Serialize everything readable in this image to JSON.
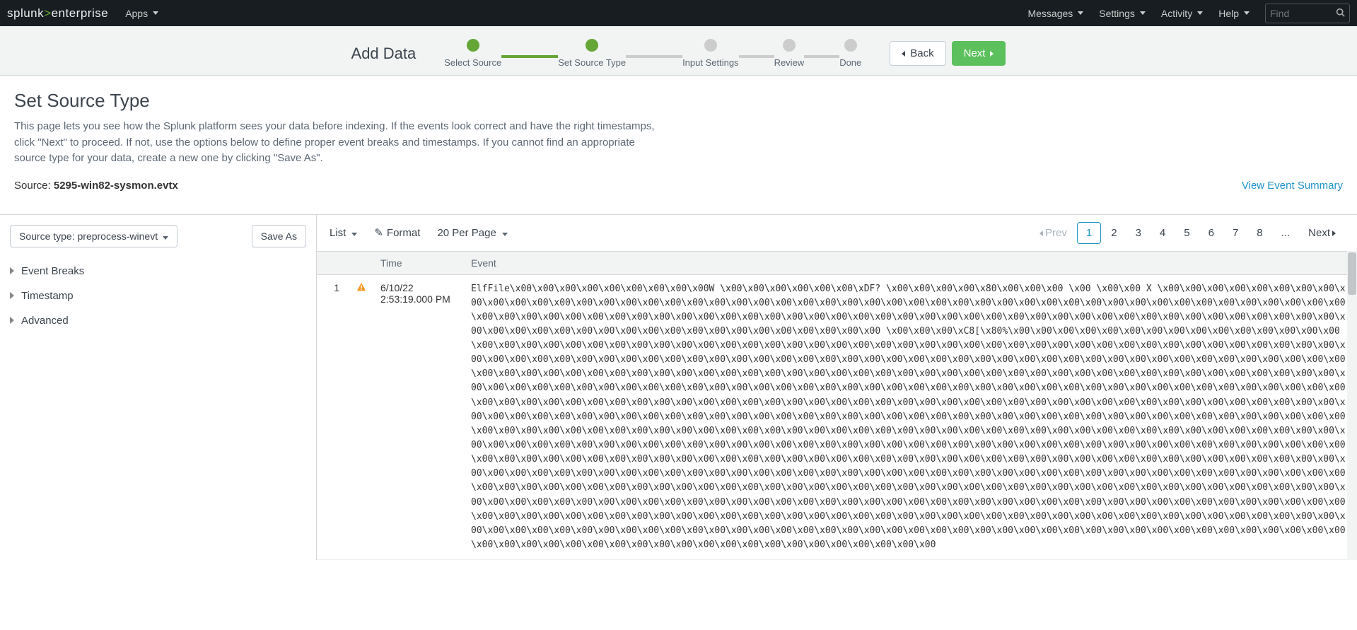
{
  "topnav": {
    "brand_prefix": "splunk",
    "brand_suffix": "enterprise",
    "apps_label": "Apps",
    "messages_label": "Messages",
    "settings_label": "Settings",
    "activity_label": "Activity",
    "help_label": "Help",
    "search_placeholder": "Find"
  },
  "wizard": {
    "title": "Add Data",
    "steps": [
      "Select Source",
      "Set Source Type",
      "Input Settings",
      "Review",
      "Done"
    ],
    "back_label": "Back",
    "next_label": "Next"
  },
  "page": {
    "title": "Set Source Type",
    "description": "This page lets you see how the Splunk platform sees your data before indexing. If the events look correct and have the right timestamps, click \"Next\" to proceed. If not, use the options below to define proper event breaks and timestamps. If you cannot find an appropriate source type for your data, create a new one by clicking \"Save As\".",
    "source_prefix": "Source: ",
    "source_value": "5295-win82-sysmon.evtx",
    "summary_link": "View Event Summary"
  },
  "left": {
    "sourcetype_btn": "Source type: preprocess-winevt",
    "saveas_btn": "Save As",
    "accordion": [
      "Event Breaks",
      "Timestamp",
      "Advanced"
    ]
  },
  "toolbar": {
    "list_label": "List",
    "format_label": "Format",
    "perpage_label": "20 Per Page",
    "prev_label": "Prev",
    "next_label": "Next",
    "pages": [
      "1",
      "2",
      "3",
      "4",
      "5",
      "6",
      "7",
      "8",
      "..."
    ],
    "active_page": "1"
  },
  "table": {
    "headers": {
      "idx": "",
      "warn": "",
      "time": "Time",
      "event": "Event"
    },
    "rows": [
      {
        "idx": "1",
        "time_line1": "6/10/22",
        "time_line2": "2:53:19.000 PM",
        "event": "ElfFile\\x00\\x00\\x00\\x00\\x00\\x00\\x00\\x00\\x00W \\x00\\x00\\x00\\x00\\x00\\x00\\xDF? \\x00\\x00\\x00\\x00\\x80\\x00\\x00\\x00 \\x00 \\x00\\x00 X \\x00\\x00\\x00\\x00\\x00\\x00\\x00\\x00\\x00\\x00\\x00\\x00\\x00\\x00\\x00\\x00\\x00\\x00\\x00\\x00\\x00\\x00\\x00\\x00\\x00\\x00\\x00\\x00\\x00\\x00\\x00\\x00\\x00\\x00\\x00\\x00\\x00\\x00\\x00\\x00\\x00\\x00\\x00\\x00\\x00\\x00\\x00\\x00\\x00\\x00\\x00\\x00\\x00\\x00\\x00\\x00\\x00\\x00\\x00\\x00\\x00\\x00\\x00\\x00\\x00\\x00\\x00\\x00\\x00\\x00\\x00\\x00\\x00\\x00\\x00\\x00\\x00\\x00\\x00\\x00\\x00\\x00\\x00\\x00\\x00\\x00\\x00\\x00\\x00\\x00\\x00\\x00\\x00\\x00\\x00\\x00\\x00\\x00\\x00\\x00\\x00\\x00\\x00\\x00\\x00\\x00 \\x00\\x00\\x00\\xC8[\\x80%\\x00\\x00\\x00\\x00\\x00\\x00\\x00\\x00\\x00\\x00\\x00\\x00\\x00\\x00\\x00\\x00\\x00\\x00\\x00\\x00\\x00\\x00\\x00\\x00\\x00\\x00\\x00\\x00\\x00\\x00\\x00\\x00\\x00\\x00\\x00\\x00\\x00\\x00\\x00\\x00\\x00\\x00\\x00\\x00\\x00\\x00\\x00\\x00\\x00\\x00\\x00\\x00\\x00\\x00\\x00\\x00\\x00\\x00\\x00\\x00\\x00\\x00\\x00\\x00\\x00\\x00\\x00\\x00\\x00\\x00\\x00\\x00\\x00\\x00\\x00\\x00\\x00\\x00\\x00\\x00\\x00\\x00\\x00\\x00\\x00\\x00\\x00\\x00\\x00\\x00\\x00\\x00\\x00\\x00\\x00\\x00\\x00\\x00\\x00\\x00\\x00\\x00\\x00\\x00\\x00\\x00\\x00\\x00\\x00\\x00\\x00\\x00\\x00\\x00\\x00\\x00\\x00\\x00\\x00\\x00\\x00\\x00\\x00\\x00\\x00\\x00\\x00\\x00\\x00\\x00\\x00\\x00\\x00\\x00\\x00\\x00\\x00\\x00\\x00\\x00\\x00\\x00\\x00\\x00\\x00\\x00\\x00\\x00\\x00\\x00\\x00\\x00\\x00\\x00\\x00\\x00\\x00\\x00\\x00\\x00\\x00\\x00\\x00\\x00\\x00\\x00\\x00\\x00\\x00\\x00\\x00\\x00\\x00\\x00\\x00\\x00\\x00\\x00\\x00\\x00\\x00\\x00\\x00\\x00\\x00\\x00\\x00\\x00\\x00\\x00\\x00\\x00\\x00\\x00\\x00\\x00\\x00\\x00\\x00\\x00\\x00\\x00\\x00\\x00\\x00\\x00\\x00\\x00\\x00\\x00\\x00\\x00\\x00\\x00\\x00\\x00\\x00\\x00\\x00\\x00\\x00\\x00\\x00\\x00\\x00\\x00\\x00\\x00\\x00\\x00\\x00\\x00\\x00\\x00\\x00\\x00\\x00\\x00\\x00\\x00\\x00\\x00\\x00\\x00\\x00\\x00\\x00\\x00\\x00\\x00\\x00\\x00\\x00\\x00\\x00\\x00\\x00\\x00\\x00\\x00\\x00\\x00\\x00\\x00\\x00\\x00\\x00\\x00\\x00\\x00\\x00\\x00\\x00\\x00\\x00\\x00\\x00\\x00\\x00\\x00\\x00\\x00\\x00\\x00\\x00\\x00\\x00\\x00\\x00\\x00\\x00\\x00\\x00\\x00\\x00\\x00\\x00\\x00\\x00\\x00\\x00\\x00\\x00\\x00\\x00\\x00\\x00\\x00\\x00\\x00\\x00\\x00\\x00\\x00\\x00\\x00\\x00\\x00\\x00\\x00\\x00\\x00\\x00\\x00\\x00\\x00\\x00\\x00\\x00\\x00\\x00\\x00\\x00\\x00\\x00\\x00\\x00\\x00\\x00\\x00\\x00\\x00\\x00\\x00\\x00\\x00\\x00\\x00\\x00\\x00\\x00\\x00\\x00\\x00\\x00\\x00\\x00\\x00\\x00\\x00\\x00\\x00\\x00\\x00\\x00\\x00\\x00\\x00\\x00\\x00\\x00\\x00\\x00\\x00\\x00\\x00\\x00\\x00\\x00\\x00\\x00\\x00\\x00\\x00\\x00\\x00\\x00\\x00\\x00\\x00\\x00\\x00\\x00\\x00\\x00\\x00\\x00\\x00\\x00\\x00\\x00\\x00\\x00\\x00\\x00\\x00\\x00\\x00\\x00\\x00\\x00\\x00\\x00\\x00\\x00\\x00\\x00\\x00\\x00\\x00\\x00\\x00\\x00\\x00\\x00\\x00\\x00\\x00\\x00\\x00\\x00\\x00\\x00\\x00\\x00\\x00\\x00\\x00\\x00\\x00\\x00\\x00\\x00\\x00\\x00\\x00\\x00\\x00\\x00\\x00\\x00\\x00\\x00\\x00\\x00\\x00\\x00\\x00\\x00\\x00\\x00\\x00\\x00\\x00\\x00\\x00\\x00\\x00\\x00\\x00\\x00\\x00\\x00\\x00\\x00\\x00\\x00\\x00\\x00\\x00\\x00\\x00\\x00\\x00\\x00\\x00\\x00\\x00\\x00\\x00\\x00\\x00\\x00\\x00\\x00\\x00\\x00\\x00\\x00\\x00\\x00\\x00\\x00\\x00\\x00\\x00\\x00\\x00\\x00\\x00\\x00\\x00\\x00\\x00\\x00\\x00\\x00\\x00\\x00\\x00\\x00\\x00\\x00\\x00\\x00\\x00\\x00\\x00\\x00\\x00\\x00\\x00\\x00\\x00\\x00\\x00\\x00\\x00\\x00\\x00\\x00\\x00\\x00\\x00\\x00\\x00\\x00\\x00\\x00\\x00\\x00\\x00\\x00\\x00\\x00\\x00\\x00\\x00\\x00\\x00\\x00\\x00\\x00\\x00\\x00\\x00\\x00\\x00\\x00\\x00\\x00\\x00\\x00\\x00\\x00\\x00\\x00\\x00\\x00\\x00\\x00\\x00\\x00\\x00\\x00\\x00\\x00\\x00\\x00"
      }
    ]
  }
}
